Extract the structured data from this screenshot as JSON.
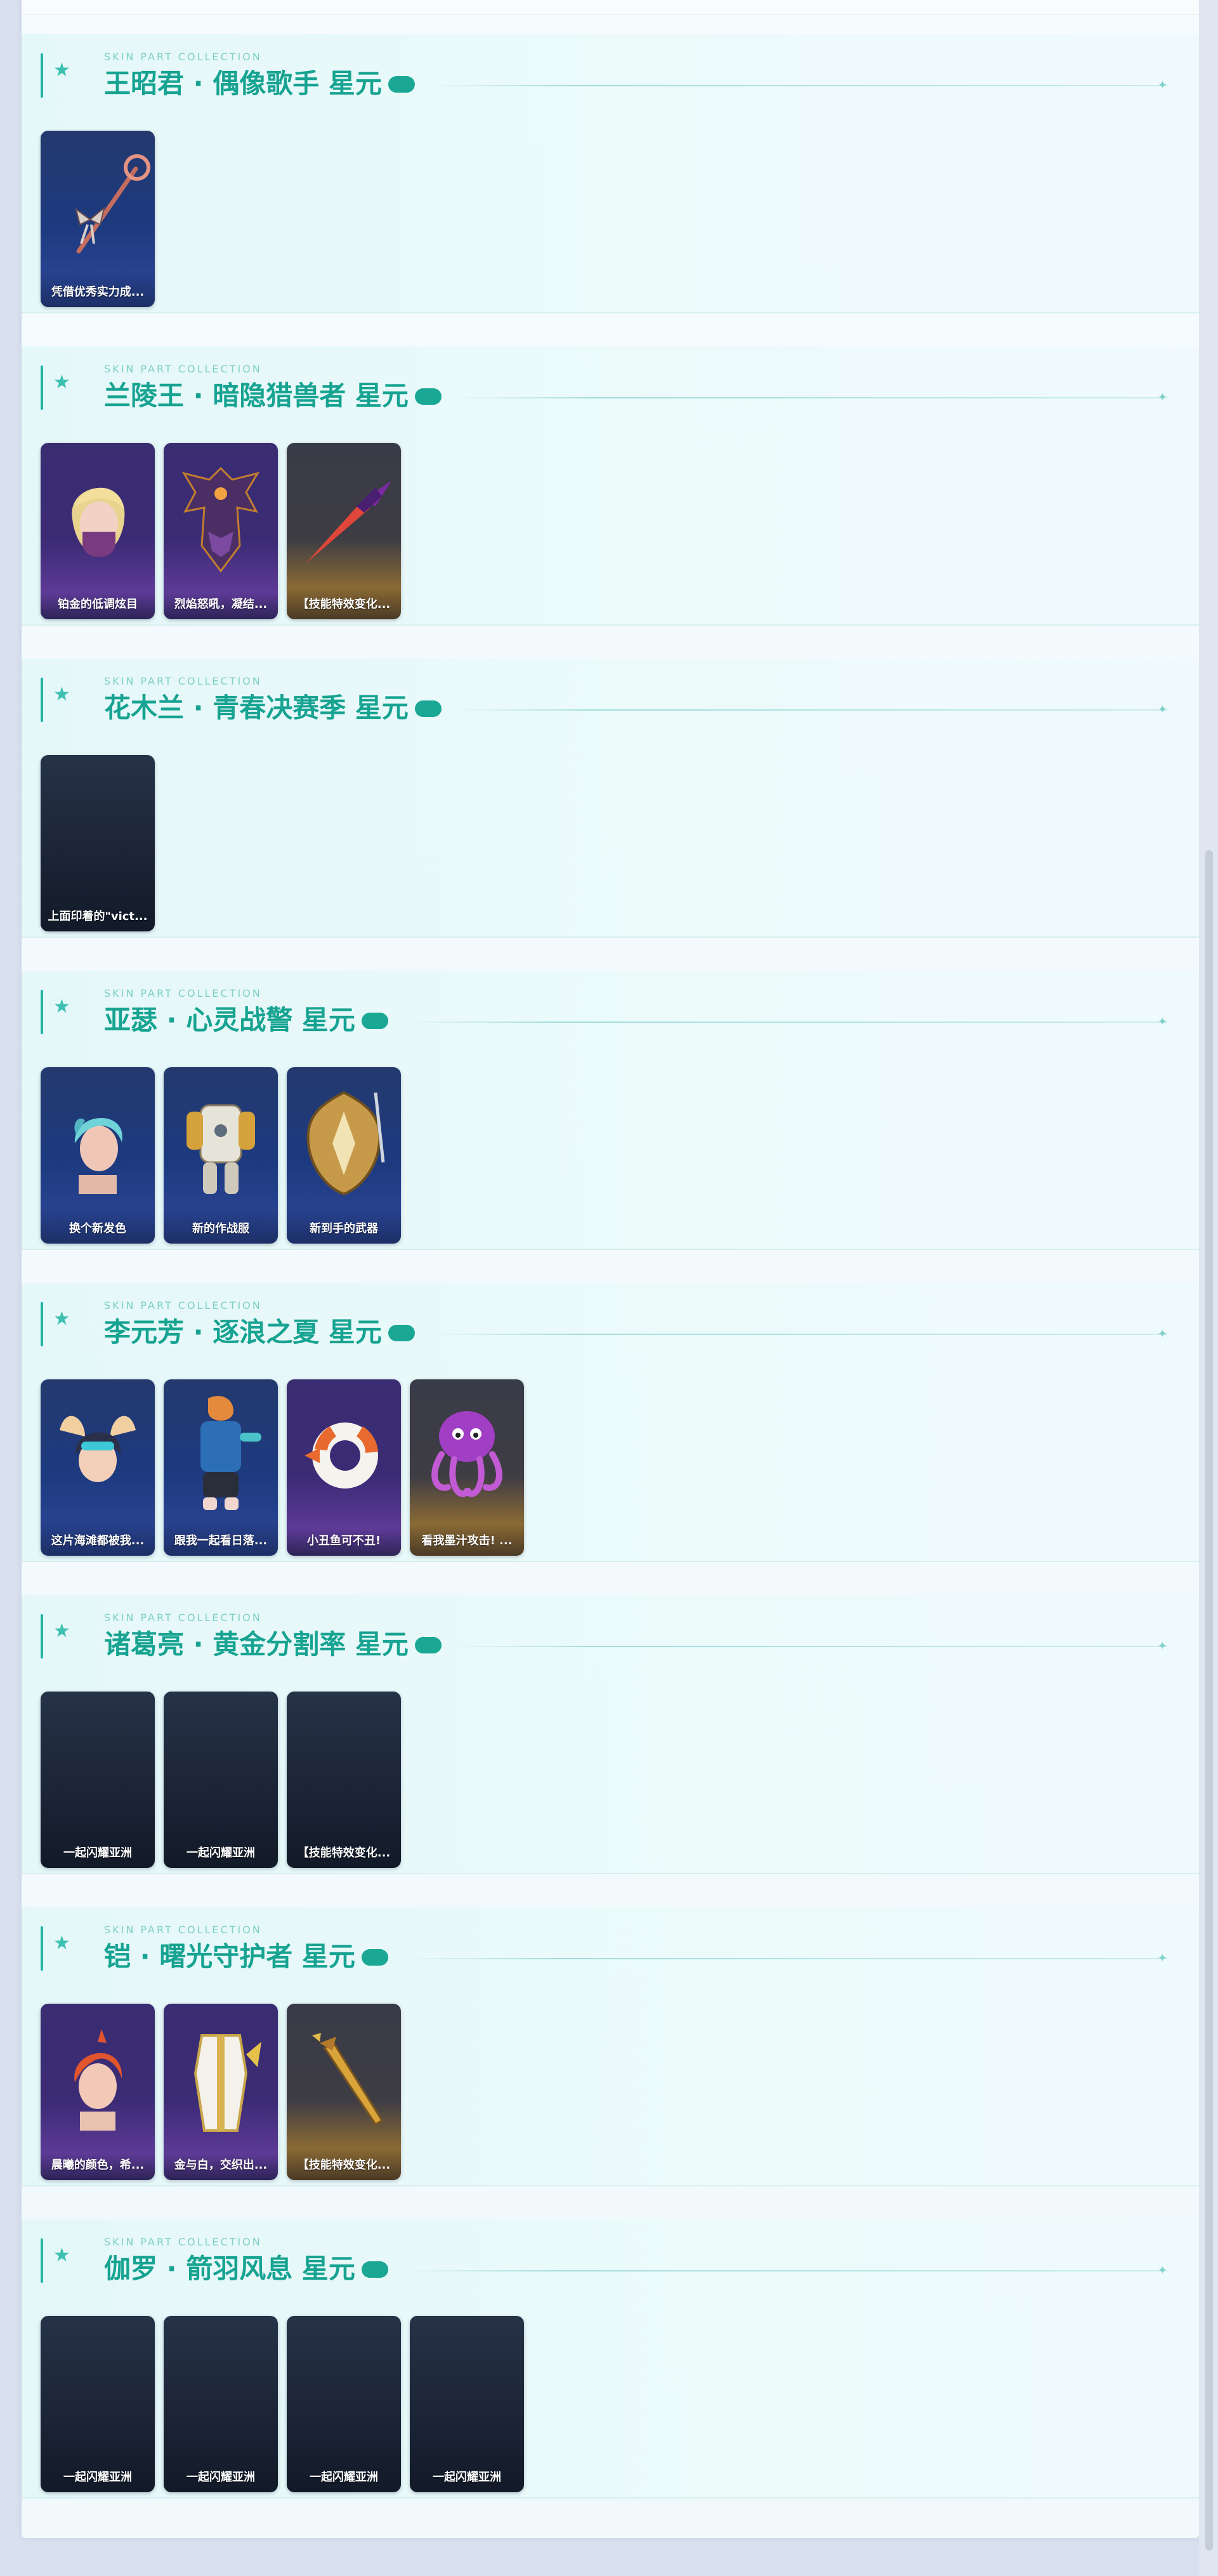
{
  "sections": [
    {
      "subtitle": "SKIN PART COLLECTION",
      "title": "王昭君 · 偶像歌手 星元",
      "parts": [
        {
          "caption": "凭借优秀实力成...",
          "theme": "blue",
          "icon": "ribbon-staff-icon"
        }
      ]
    },
    {
      "subtitle": "SKIN PART COLLECTION",
      "title": "兰陵王 · 暗隐猎兽者 星元",
      "parts": [
        {
          "caption": "铂金的低调炫目",
          "theme": "purple",
          "icon": "masked-head-icon"
        },
        {
          "caption": "烈焰怒吼，凝结...",
          "theme": "purple",
          "icon": "dark-armor-icon"
        },
        {
          "caption": "【技能特效变化...",
          "theme": "gold",
          "icon": "red-blade-icon"
        }
      ]
    },
    {
      "subtitle": "SKIN PART COLLECTION",
      "title": "花木兰 · 青春决赛季 星元",
      "parts": [
        {
          "caption": "上面印着的\"vict...",
          "theme": "dark",
          "icon": "empty-icon"
        }
      ]
    },
    {
      "subtitle": "SKIN PART COLLECTION",
      "title": "亚瑟 · 心灵战警 星元",
      "parts": [
        {
          "caption": "换个新发色",
          "theme": "blue",
          "icon": "cyan-hair-head-icon"
        },
        {
          "caption": "新的作战服",
          "theme": "blue",
          "icon": "white-armor-icon"
        },
        {
          "caption": "新到手的武器",
          "theme": "blue",
          "icon": "golden-shield-icon"
        }
      ]
    },
    {
      "subtitle": "SKIN PART COLLECTION",
      "title": "李元芳 · 逐浪之夏 星元",
      "parts": [
        {
          "caption": "这片海滩都被我...",
          "theme": "blue",
          "icon": "winged-head-icon"
        },
        {
          "caption": "跟我一起看日落...",
          "theme": "blue",
          "icon": "summer-outfit-icon"
        },
        {
          "caption": "小丑鱼可不丑!",
          "theme": "purple",
          "icon": "swim-ring-icon"
        },
        {
          "caption": "看我墨汁攻击! ...",
          "theme": "gold",
          "icon": "octopus-icon"
        }
      ]
    },
    {
      "subtitle": "SKIN PART COLLECTION",
      "title": "诸葛亮 · 黄金分割率 星元",
      "parts": [
        {
          "caption": "一起闪耀亚洲",
          "theme": "dark",
          "icon": "empty-icon"
        },
        {
          "caption": "一起闪耀亚洲",
          "theme": "dark",
          "icon": "empty-icon"
        },
        {
          "caption": "【技能特效变化...",
          "theme": "dark",
          "icon": "empty-icon"
        }
      ]
    },
    {
      "subtitle": "SKIN PART COLLECTION",
      "title": "铠 · 曙光守护者 星元",
      "parts": [
        {
          "caption": "晨曦的颜色，希...",
          "theme": "purple",
          "icon": "red-hair-head-icon"
        },
        {
          "caption": "金与白，交织出...",
          "theme": "purple",
          "icon": "white-gold-armor-icon"
        },
        {
          "caption": "【技能特效变化...",
          "theme": "gold",
          "icon": "golden-sword-icon"
        }
      ]
    },
    {
      "subtitle": "SKIN PART COLLECTION",
      "title": "伽罗 · 箭羽风息 星元",
      "parts": [
        {
          "caption": "一起闪耀亚洲",
          "theme": "dark",
          "icon": "empty-icon"
        },
        {
          "caption": "一起闪耀亚洲",
          "theme": "dark",
          "icon": "empty-icon"
        },
        {
          "caption": "一起闪耀亚洲",
          "theme": "dark",
          "icon": "empty-icon"
        },
        {
          "caption": "一起闪耀亚洲",
          "theme": "dark",
          "icon": "empty-icon"
        }
      ]
    }
  ],
  "colors": {
    "accent": "#17a391",
    "pill": "#1aa894",
    "subtitle": "#7fcfc6"
  }
}
